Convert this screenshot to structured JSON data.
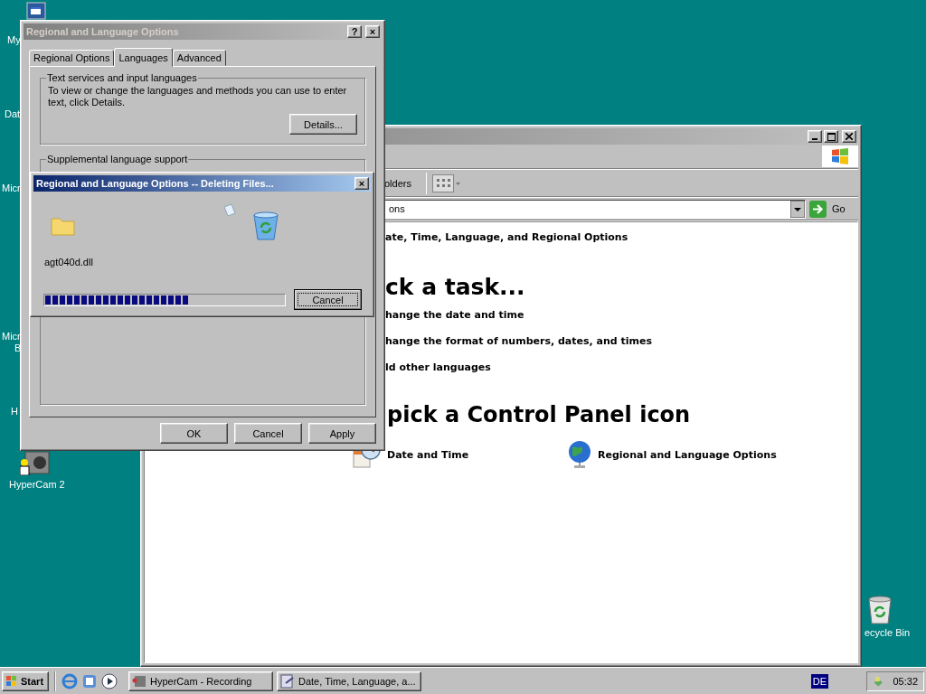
{
  "desktop_icons": [
    {
      "label": "My"
    },
    {
      "label": "Dat"
    },
    {
      "label": "Micr"
    },
    {
      "label": "Micr",
      "label_2": "B"
    },
    {
      "label": "H"
    },
    {
      "label": "HyperCam 2"
    },
    {
      "label": "ecycle Bin"
    }
  ],
  "explorer": {
    "toolbar": {
      "folders": "olders"
    },
    "address": {
      "value": "ons",
      "go": "Go"
    },
    "category": "ate, Time, Language, and Regional Options",
    "task_heading": "ck a task...",
    "tasks": [
      "hange the date and time",
      "hange the format of numbers, dates, and times",
      "ld other languages"
    ],
    "icon_heading": "pick a Control Panel icon",
    "icons": [
      {
        "kind": "clock",
        "label": "Date and Time"
      },
      {
        "kind": "globe",
        "label": "Regional and Language Options"
      }
    ]
  },
  "options_dialog": {
    "title": "Regional and Language Options",
    "title_buttons": [
      "?",
      "×"
    ],
    "tabs": [
      {
        "label": "Regional Options",
        "selected": false
      },
      {
        "label": "Languages",
        "selected": true
      },
      {
        "label": "Advanced",
        "selected": false
      }
    ],
    "group_1": {
      "legend": "Text services and input languages",
      "text": "To view or change the languages and methods you can use to enter text, click Details.",
      "button": "Details..."
    },
    "group_2": {
      "legend": "Supplemental language support"
    },
    "buttons": [
      "OK",
      "Cancel",
      "Apply"
    ]
  },
  "progress_dialog": {
    "title": "Regional and Language Options -- Deleting Files...",
    "close": "×",
    "file": "agt040d.dll",
    "progress": {
      "level": 0.6
    },
    "cancel": "Cancel"
  },
  "taskbar": {
    "start": "Start",
    "tasks": [
      {
        "label": "HyperCam - Recording",
        "kind": "camera",
        "selected": false
      },
      {
        "label": "Date, Time, Language, a...",
        "kind": "panel",
        "selected": false
      }
    ],
    "language": "DE",
    "clock": "05:32"
  }
}
